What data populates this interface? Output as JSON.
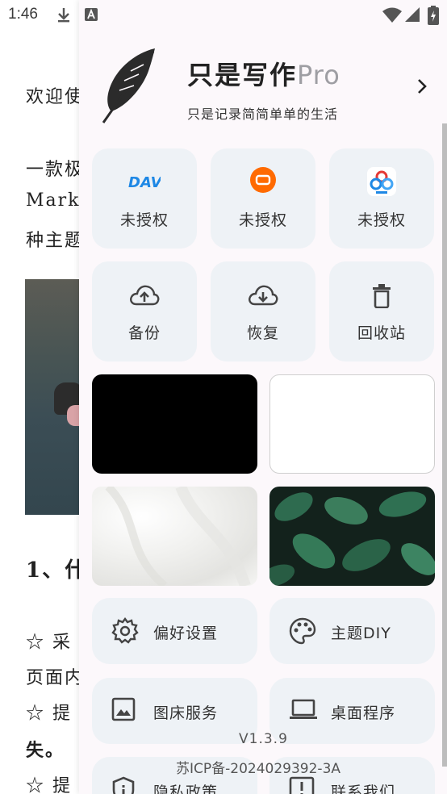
{
  "status_bar": {
    "time": "1:46",
    "icons": [
      "download-icon",
      "a-icon",
      "wifi-icon",
      "signal-icon",
      "battery-charging-icon"
    ]
  },
  "document": {
    "lines": [
      "欢迎使",
      "一款极",
      "Markd",
      "种主题",
      "1、什",
      "☆ 采",
      "页面内",
      "☆ 提",
      "失。",
      "☆ 提"
    ]
  },
  "drawer": {
    "app_title_main": "只是写作",
    "app_title_pro": "Pro",
    "app_subtitle": "只是记录简简单单的生活",
    "sync_tiles": [
      {
        "icon": "webdav-icon",
        "label": "未授权"
      },
      {
        "icon": "aliyun-drive-icon",
        "label": "未授权"
      },
      {
        "icon": "baidu-netdisk-icon",
        "label": "未授权"
      }
    ],
    "action_tiles": [
      {
        "icon": "cloud-upload-icon",
        "label": "备份"
      },
      {
        "icon": "cloud-download-icon",
        "label": "恢复"
      },
      {
        "icon": "trash-icon",
        "label": "回收站"
      }
    ],
    "themes": [
      "black",
      "white",
      "silk",
      "leaves"
    ],
    "menu": [
      {
        "icon": "gear-icon",
        "label": "偏好设置"
      },
      {
        "icon": "palette-icon",
        "label": "主题DIY"
      },
      {
        "icon": "image-icon",
        "label": "图床服务"
      },
      {
        "icon": "laptop-icon",
        "label": "桌面程序"
      },
      {
        "icon": "shield-icon",
        "label": "隐私政策"
      },
      {
        "icon": "alert-icon",
        "label": "联系我们"
      }
    ],
    "version": "V1.3.9",
    "icp": "苏ICP备-2024029392-3A"
  },
  "colors": {
    "drawer_bg": "#fcf8fb",
    "tile_bg": "#eef2f6",
    "webdav_blue": "#1e88e5",
    "aliyun_orange": "#ff6a00"
  }
}
